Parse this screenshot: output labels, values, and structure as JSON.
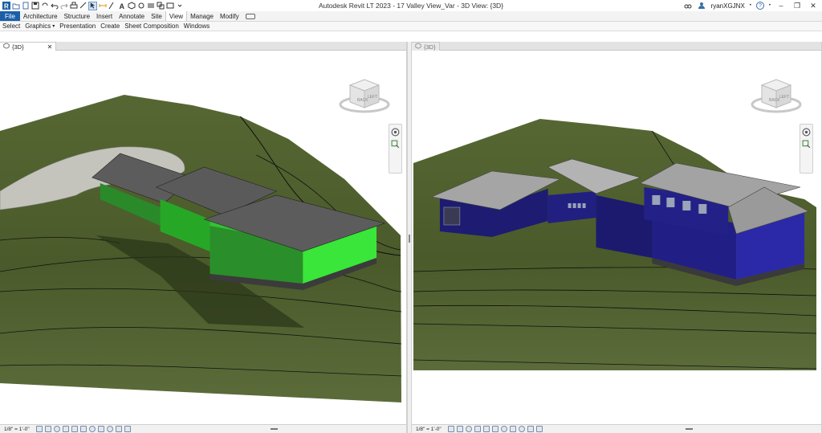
{
  "app": {
    "title": "Autodesk Revit LT 2023 - 17 Valley View_Var - 3D View: {3D}",
    "username": "ryanXGJNX",
    "help_label": "?",
    "window_controls": {
      "minimize": "–",
      "restore": "❐",
      "close": "✕"
    }
  },
  "ribbon": {
    "tabs": [
      {
        "label": "File"
      },
      {
        "label": "Architecture"
      },
      {
        "label": "Structure"
      },
      {
        "label": "Insert"
      },
      {
        "label": "Annotate"
      },
      {
        "label": "Site"
      },
      {
        "label": "View"
      },
      {
        "label": "Manage"
      },
      {
        "label": "Modify"
      }
    ],
    "active_tab": "View",
    "panels": [
      {
        "label": "Select"
      },
      {
        "label": "Graphics"
      },
      {
        "label": "Presentation"
      },
      {
        "label": "Create"
      },
      {
        "label": "Sheet Composition"
      },
      {
        "label": "Windows"
      }
    ]
  },
  "views": [
    {
      "tab_label": "{3D}",
      "close_label": "✕",
      "scale": "1/8\" = 1'-0\"",
      "viewcube_faces": {
        "back": "BACK",
        "left": "LEFT"
      },
      "wall_color": "#2db22d",
      "roof_color": "#5c5c5c",
      "terrain_color": "#4f5f2c"
    },
    {
      "tab_label": "{3D}",
      "scale": "1/8\" = 1'-0\"",
      "viewcube_faces": {
        "back": "BACK",
        "left": "LEFT"
      },
      "wall_color": "#1b1a6e",
      "roof_color": "#9d9d9d",
      "terrain_color": "#4f5f2c"
    }
  ],
  "colors": {
    "file_tab": "#1c5fa8",
    "terrain_light": "#5a6a32",
    "terrain_dark": "#2f3a1c",
    "driveway": "#c4c4bc"
  }
}
